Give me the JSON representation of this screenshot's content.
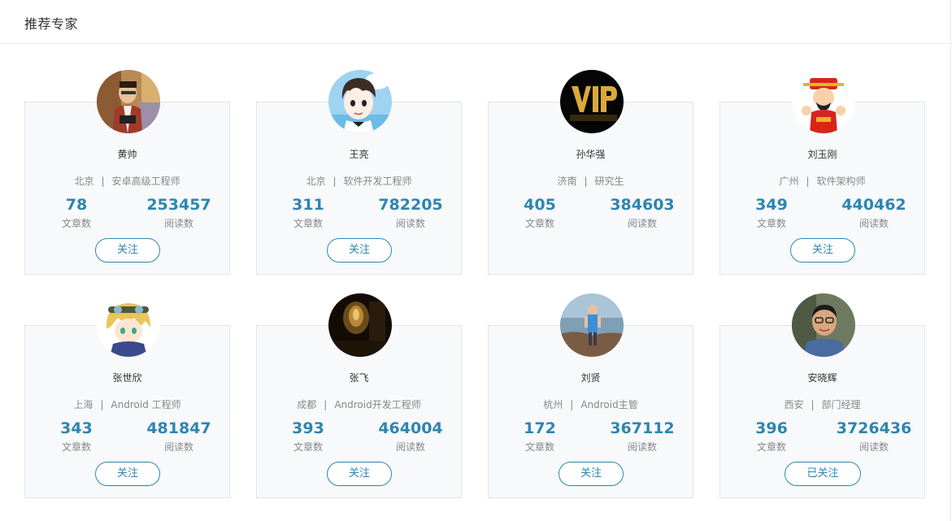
{
  "header": {
    "title": "推荐专家"
  },
  "experts": [
    {
      "name": "黄帅",
      "city": "北京",
      "title": "安卓高级工程师",
      "articles": "78",
      "reads": "253457",
      "articles_label": "文章数",
      "reads_label": "阅读数",
      "follow_label": "关注",
      "followed": false,
      "avatar": "avatar-photo-man"
    },
    {
      "name": "王亮",
      "city": "北京",
      "title": "软件开发工程师",
      "articles": "311",
      "reads": "782205",
      "articles_label": "文章数",
      "reads_label": "阅读数",
      "follow_label": "关注",
      "followed": false,
      "avatar": "avatar-cartoon-boy"
    },
    {
      "name": "孙华强",
      "city": "济南",
      "title": "研究生",
      "articles": "405",
      "reads": "384603",
      "articles_label": "文章数",
      "reads_label": "阅读数",
      "follow_label": "关注",
      "followed": false,
      "avatar": "avatar-vip"
    },
    {
      "name": "刘玉刚",
      "city": "广州",
      "title": "软件架构师",
      "articles": "349",
      "reads": "440462",
      "articles_label": "文章数",
      "reads_label": "阅读数",
      "follow_label": "关注",
      "followed": false,
      "avatar": "avatar-god-of-wealth"
    },
    {
      "name": "张世欣",
      "city": "上海",
      "title": "Android 工程师",
      "articles": "343",
      "reads": "481847",
      "articles_label": "文章数",
      "reads_label": "阅读数",
      "follow_label": "关注",
      "followed": false,
      "avatar": "avatar-anime-boy"
    },
    {
      "name": "张飞",
      "city": "成都",
      "title": "Android开发工程师",
      "articles": "393",
      "reads": "464004",
      "articles_label": "文章数",
      "reads_label": "阅读数",
      "follow_label": "关注",
      "followed": false,
      "avatar": "avatar-dark-room"
    },
    {
      "name": "刘贤",
      "city": "杭州",
      "title": "Android主管",
      "articles": "172",
      "reads": "367112",
      "articles_label": "文章数",
      "reads_label": "阅读数",
      "follow_label": "关注",
      "followed": false,
      "avatar": "avatar-seaside-person"
    },
    {
      "name": "安晓辉",
      "city": "西安",
      "title": "部门经理",
      "articles": "396",
      "reads": "3726436",
      "articles_label": "文章数",
      "reads_label": "阅读数",
      "follow_label": "已关注",
      "followed": true,
      "avatar": "avatar-man-glasses"
    }
  ],
  "separator": "|",
  "colors": {
    "accent": "#2d86b0",
    "card_bg": "#f7f9fb",
    "border": "#e3e6ea"
  }
}
